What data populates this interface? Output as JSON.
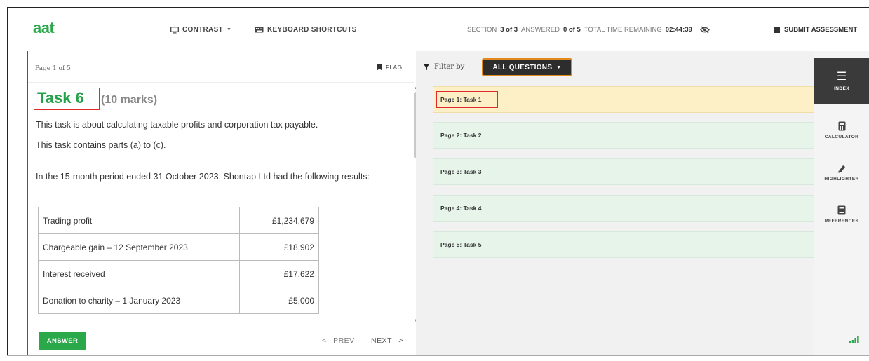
{
  "header": {
    "logo": "aat",
    "contrast_label": "CONTRAST",
    "shortcuts_label": "KEYBOARD SHORTCUTS",
    "section_label": "SECTION",
    "section_value": "3 of 3",
    "answered_label": "ANSWERED",
    "answered_value": "0 of 5",
    "time_label": "TOTAL TIME REMAINING",
    "time_value": "02:44:39",
    "submit_label": "SUBMIT ASSESSMENT"
  },
  "question": {
    "page_indicator": "Page 1 of 5",
    "flag_label": "FLAG",
    "task_title": "Task 6",
    "task_marks": "(10 marks)",
    "paragraphs": [
      "This task is about calculating taxable profits and corporation tax payable.",
      "This task contains parts (a) to (c).",
      "In the 15-month period ended 31 October 2023, Shontap Ltd had the following results:"
    ],
    "table": [
      {
        "label": "Trading profit",
        "amount": "£1,234,679"
      },
      {
        "label": "Chargeable gain – 12 September 2023",
        "amount": "£18,902"
      },
      {
        "label": "Interest received",
        "amount": "£17,622"
      },
      {
        "label": "Donation to charity – 1 January 2023",
        "amount": "£5,000"
      }
    ],
    "answer_label": "ANSWER",
    "prev_label": "PREV",
    "next_label": "NEXT"
  },
  "index": {
    "filter_label": "Filter by",
    "filter_value": "ALL QUESTIONS",
    "items": [
      {
        "label": "Page 1: Task 1",
        "state": "current"
      },
      {
        "label": "Page 2: Task 2",
        "state": "normal"
      },
      {
        "label": "Page 3: Task 3",
        "state": "normal"
      },
      {
        "label": "Page 4: Task 4",
        "state": "normal"
      },
      {
        "label": "Page 5: Task 5",
        "state": "normal"
      }
    ]
  },
  "tools": {
    "items": [
      {
        "label": "INDEX",
        "icon": "menu-icon"
      },
      {
        "label": "CALCULATOR",
        "icon": "calculator-icon"
      },
      {
        "label": "HIGHLIGHTER",
        "icon": "highlighter-icon"
      },
      {
        "label": "REFERENCES",
        "icon": "book-icon"
      }
    ]
  },
  "colors": {
    "brand_green": "#2aa84a",
    "highlight_red": "#e02a2a",
    "current_card": "#fdf0c7",
    "card": "#e6f4ea",
    "filter_border": "#e08a1e"
  }
}
